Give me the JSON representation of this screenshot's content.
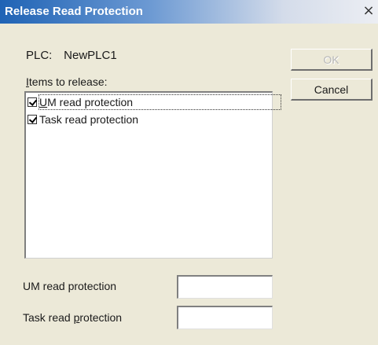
{
  "window": {
    "title": "Release Read Protection",
    "close_glyph": "×"
  },
  "plc": {
    "label": "PLC:",
    "name": "NewPLC1"
  },
  "items": {
    "label_mnemonic": "I",
    "label_rest": "tems to release:",
    "list": [
      {
        "mnemonic": "U",
        "rest": "M read protection",
        "checked": true,
        "focused": true
      },
      {
        "mnemonic": "",
        "rest": "Task read protection",
        "checked": true,
        "focused": false
      }
    ]
  },
  "buttons": {
    "ok": "OK",
    "cancel": "Cancel"
  },
  "fields": {
    "um_label": "UM read protection",
    "um_value": "",
    "task_label_pre": "Task read ",
    "task_label_mnemonic": "p",
    "task_label_post": "rotection",
    "task_value": ""
  },
  "colors": {
    "titlebar_start": "#1f63b5",
    "dialog_bg": "#ece9d8"
  }
}
